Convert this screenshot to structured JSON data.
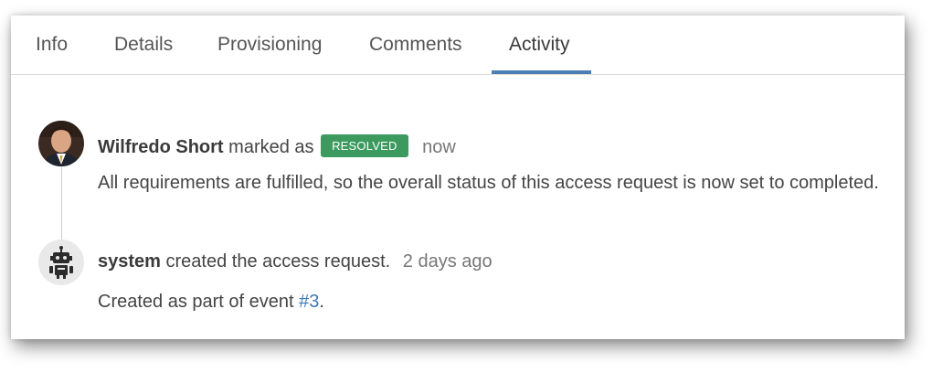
{
  "tabs": [
    {
      "label": "Info"
    },
    {
      "label": "Details"
    },
    {
      "label": "Provisioning"
    },
    {
      "label": "Comments"
    },
    {
      "label": "Activity"
    }
  ],
  "active_tab": "Activity",
  "activity": [
    {
      "actor": "Wilfredo Short",
      "action": "marked as",
      "badge": "RESOLVED",
      "time": "now",
      "message": "All requirements are fulfilled, so the overall status of this access request is now set to completed."
    },
    {
      "actor": "system",
      "action": "created the access request.",
      "time": "2 days ago",
      "message_prefix": "Created as part of event",
      "event_link": "#3",
      "message_suffix": "."
    }
  ],
  "colors": {
    "accent": "#4a7fb5",
    "badge_resolved": "#3c9a5f",
    "link": "#3d7ab8"
  },
  "icons": {
    "user_avatar": "user-avatar-photo",
    "system_avatar": "robot-icon"
  }
}
